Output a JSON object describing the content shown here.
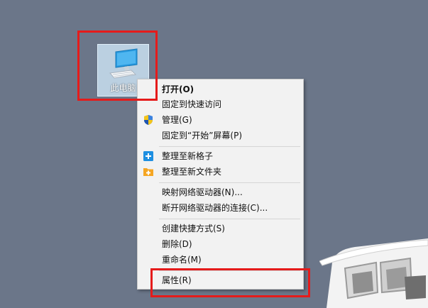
{
  "desktop": {
    "icon_label": "此电脑",
    "icon": "computer-monitor-icon"
  },
  "menu": {
    "open": "打开(O)",
    "pin_quick_access": "固定到快速访问",
    "manage": "管理(G)",
    "pin_start": "固定到“开始”屏幕(P)",
    "organize_new_grid": "整理至新格子",
    "organize_new_folder": "整理至新文件夹",
    "map_drive": "映射网络驱动器(N)...",
    "disconnect_drive": "断开网络驱动器的连接(C)...",
    "create_shortcut": "创建快捷方式(S)",
    "delete": "删除(D)",
    "rename": "重命名(M)",
    "properties": "属性(R)"
  },
  "colors": {
    "desktop_bg": "#6b7689",
    "highlight": "#e51b1b",
    "menu_bg": "#f2f2f2",
    "plus_blue": "#1e8fe1",
    "folder_yellow": "#f5a623"
  }
}
